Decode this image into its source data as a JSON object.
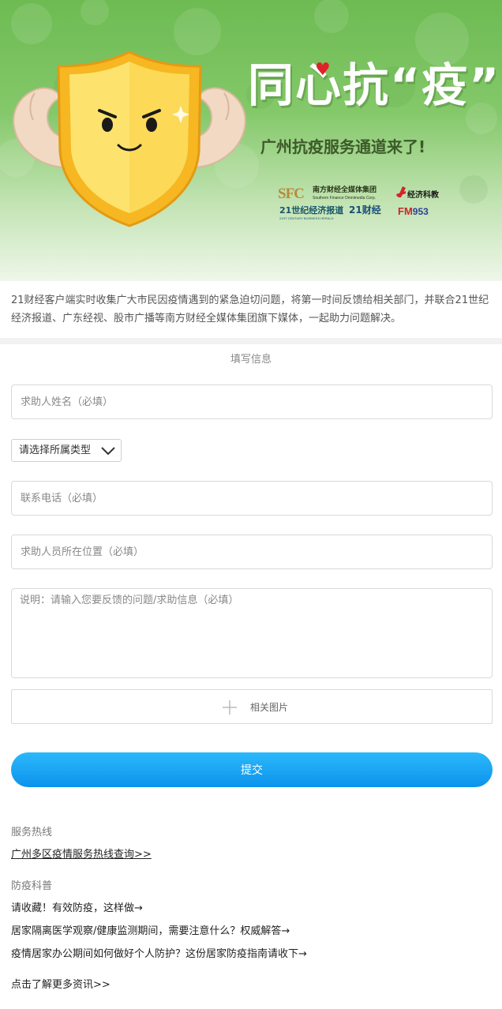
{
  "banner": {
    "headline_main": "同心抗",
    "headline_quoted": "疫",
    "heart_icon": "heart-icon",
    "subline": "广州抗疫服务通道来了!",
    "logos": {
      "sfc_mark": "SFC",
      "sfc_name": "南方财经全媒体集团",
      "sfc_english": "Southern Finance Omnimedia Corp.",
      "herald_name": "21世纪经济报道",
      "herald_english": "21ST CENTURY BUSINESS HERALD",
      "caijing_name": "21财经",
      "jjkj_name": "经济科教",
      "fm_prefix": "FM",
      "fm_number": "953"
    }
  },
  "intro": {
    "text": "21财经客户端实时收集广大市民因疫情遇到的紧急迫切问题，将第一时间反馈给相关部门，并联合21世纪经济报道、广东经视、股市广播等南方财经全媒体集团旗下媒体，一起助力问题解决。"
  },
  "form": {
    "title": "填写信息",
    "name_placeholder": "求助人姓名（必填）",
    "type_select": {
      "selected": "请选择所属类型",
      "icon": "chevron-down-icon"
    },
    "phone_placeholder": "联系电话（必填）",
    "location_placeholder": "求助人员所在位置（必填）",
    "description_placeholder": "说明：请输入您要反馈的问题/求助信息（必填）",
    "upload": {
      "icon": "plus-icon",
      "label": "相关图片"
    },
    "submit_label": "提交",
    "submit_color": "#1aa5f5"
  },
  "hotline": {
    "title": "服务热线",
    "link": "广州多区疫情服务热线查询>>"
  },
  "science": {
    "title": "防疫科普",
    "items": [
      "请收藏！有效防疫，这样做→",
      "居家隔离医学观察/健康监测期间，需要注意什么？权威解答→",
      "疫情居家办公期间如何做好个人防护？这份居家防疫指南请收下→"
    ]
  },
  "more_link": "点击了解更多资讯>>"
}
